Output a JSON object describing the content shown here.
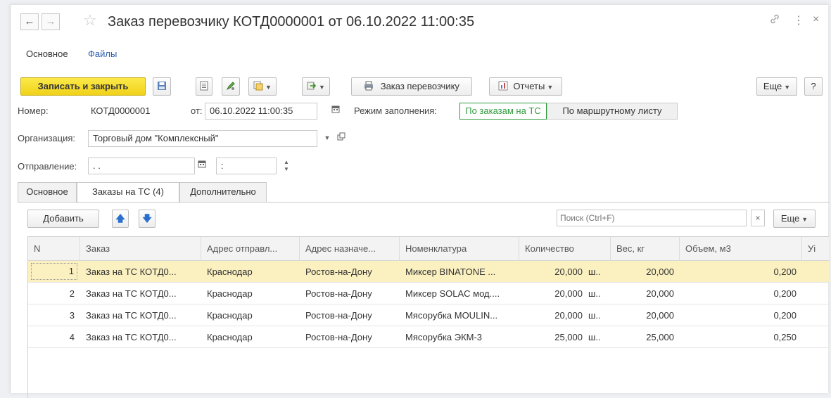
{
  "window": {
    "title": "Заказ перевозчику КОТД0000001 от 06.10.2022 11:00:35",
    "back_glyph": "←",
    "forward_glyph": "→",
    "star_glyph": "☆",
    "link_glyph": "🔗",
    "more_glyph": "⋮",
    "close_glyph": "×"
  },
  "sections": {
    "main": "Основное",
    "files": "Файлы"
  },
  "toolbar": {
    "save_close": "Записать и закрыть",
    "carrier_order": "Заказ перевозчику",
    "reports": "Отчеты",
    "more": "Еще",
    "help": "?"
  },
  "form": {
    "number_label": "Номер:",
    "number_value": "КОТД0000001",
    "date_label": "от:",
    "date_value": "06.10.2022 11:00:35",
    "fill_mode_label": "Режим заполнения:",
    "fill_mode_options": [
      "По заказам на ТС",
      "По маршрутному листу"
    ],
    "org_label": "Организация:",
    "org_value": "Торговый дом \"Комплексный\"",
    "departure_label": "Отправление:",
    "departure_date": " . .",
    "departure_time": " :"
  },
  "tabs": [
    "Основное",
    "Заказы на ТС (4)",
    "Дополнительно"
  ],
  "table_toolbar": {
    "add": "Добавить",
    "search_placeholder": "Поиск (Ctrl+F)",
    "clear": "×",
    "more": "Еще"
  },
  "table": {
    "columns": [
      "N",
      "Заказ",
      "Адрес отправл...",
      "Адрес назначе...",
      "Номенклатура",
      "Количество",
      "Вес, кг",
      "Объем, м3",
      "Уі"
    ],
    "rows": [
      [
        "1",
        "Заказ на ТС КОТД0...",
        "Краснодар",
        "Ростов-на-Дону",
        "Миксер BINATONE ...",
        "20,000",
        "ш..",
        "20,000",
        "0,200"
      ],
      [
        "2",
        "Заказ на ТС КОТД0...",
        "Краснодар",
        "Ростов-на-Дону",
        "Миксер SOLAC мод....",
        "20,000",
        "ш..",
        "20,000",
        "0,200"
      ],
      [
        "3",
        "Заказ на ТС КОТД0...",
        "Краснодар",
        "Ростов-на-Дону",
        "Мясорубка MOULIN...",
        "20,000",
        "ш..",
        "20,000",
        "0,200"
      ],
      [
        "4",
        "Заказ на ТС КОТД0...",
        "Краснодар",
        "Ростов-на-Дону",
        "Мясорубка ЭКМ-3",
        "25,000",
        "ш..",
        "25,000",
        "0,250"
      ]
    ]
  },
  "colors": {
    "accent_yellow": "#f1d21a",
    "selected_row": "#fbf0c0",
    "active_toggle": "#2f9a3c",
    "link": "#2a5db0"
  }
}
